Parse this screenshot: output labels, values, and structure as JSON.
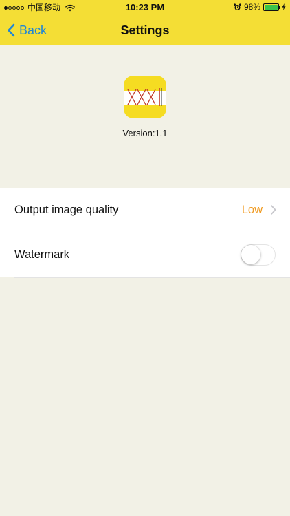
{
  "status_bar": {
    "carrier": "中国移动",
    "time": "10:23 PM",
    "battery_percent": "98%",
    "battery_level": 0.98,
    "signal_bars_filled": 1,
    "signal_bars_total": 5,
    "icons": [
      "wifi-icon",
      "alarm-icon",
      "battery-icon",
      "charging-bolt-icon"
    ]
  },
  "nav": {
    "back_label": "Back",
    "title": "Settings",
    "colors": {
      "bar_background": "#f4de35",
      "back_tint": "#1e86d6"
    }
  },
  "app": {
    "version": "Version:1.1",
    "icon": "app-logo-icon",
    "icon_background": "#f5dc22"
  },
  "settings": {
    "output_quality": {
      "label": "Output image quality",
      "value": "Low",
      "value_color": "#f09a20"
    },
    "watermark": {
      "label": "Watermark",
      "enabled": false
    }
  },
  "colors": {
    "page_background": "#f2f1e6",
    "list_background": "#ffffff"
  }
}
